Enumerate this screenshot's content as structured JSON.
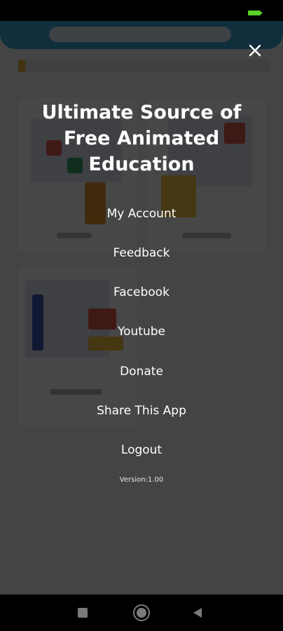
{
  "menu": {
    "title_line1": "Ultimate Source of",
    "title_line2": "Free Animated",
    "title_line3": "Education",
    "items": [
      {
        "label": "My Account"
      },
      {
        "label": "Feedback"
      },
      {
        "label": "Facebook"
      },
      {
        "label": "Youtube"
      },
      {
        "label": "Donate"
      },
      {
        "label": "Share This App"
      },
      {
        "label": "Logout"
      }
    ],
    "version": "Version:1.00"
  },
  "icons": {
    "close": "close-icon",
    "battery": "battery-icon",
    "recents": "recents-icon",
    "home": "home-icon",
    "back": "back-icon"
  },
  "colors": {
    "overlay": "#000000",
    "text": "#ffffff",
    "battery": "#59d12a",
    "header_blue": "#3aa7d8"
  }
}
